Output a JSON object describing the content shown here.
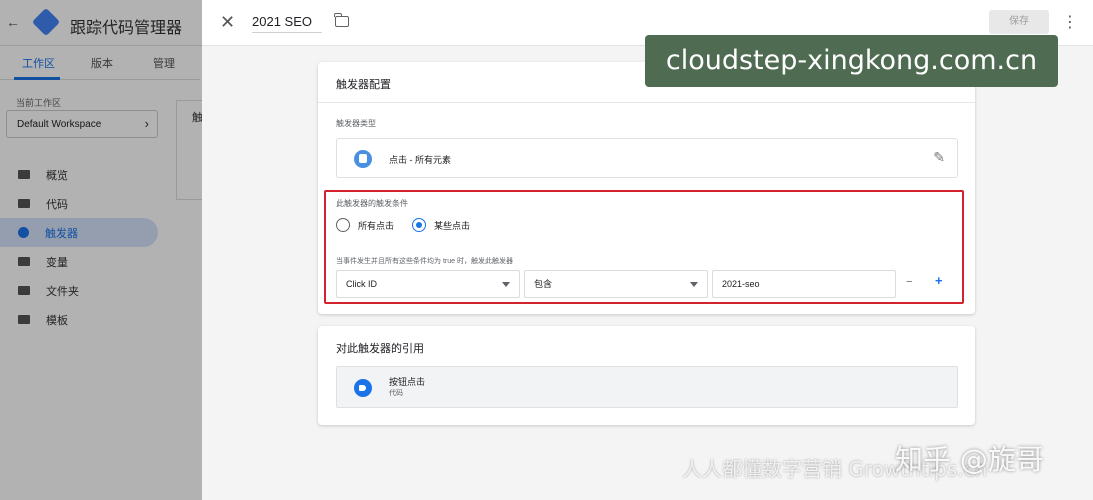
{
  "app": {
    "back_icon": "arrow-left-icon",
    "title": "跟踪代码管理器",
    "tabs": [
      "工作区",
      "版本",
      "管理"
    ],
    "workspace_label": "当前工作区",
    "workspace_name": "Default Workspace",
    "nav": [
      {
        "label": "概览",
        "icon": "overview-icon"
      },
      {
        "label": "代码",
        "icon": "tag-icon"
      },
      {
        "label": "触发器",
        "icon": "trigger-icon",
        "active": true
      },
      {
        "label": "变量",
        "icon": "variable-icon"
      },
      {
        "label": "文件夹",
        "icon": "folder-icon"
      },
      {
        "label": "模板",
        "icon": "template-icon"
      }
    ],
    "content_peek": "触"
  },
  "panel": {
    "trigger_name": "2021 SEO",
    "save_label": "保存",
    "config": {
      "title": "触发器配置",
      "type_label": "触发器类型",
      "type_value": "点击 - 所有元素",
      "condition_label": "此触发器的触发条件",
      "options": [
        "所有点击",
        "某些点击"
      ],
      "selected_option": "某些点击",
      "when_label": "当事件发生并且所有这些条件均为 true 时，触发此触发器",
      "variable": "Click ID",
      "operator": "包含",
      "value": "2021-seo",
      "minus": "−",
      "plus": "+"
    },
    "references": {
      "title": "对此触发器的引用",
      "item_name": "按钮点击",
      "item_type": "代码"
    }
  },
  "watermarks": {
    "banner": "cloudstep-xingkong.com.cn",
    "zhihu": "知乎 @旋哥",
    "sub": "人人都懂数字营销 Growthtips.cn"
  },
  "colors": {
    "accent": "#1a73e8",
    "highlight_border": "#d3212d",
    "banner_bg": "#4f6b52"
  }
}
